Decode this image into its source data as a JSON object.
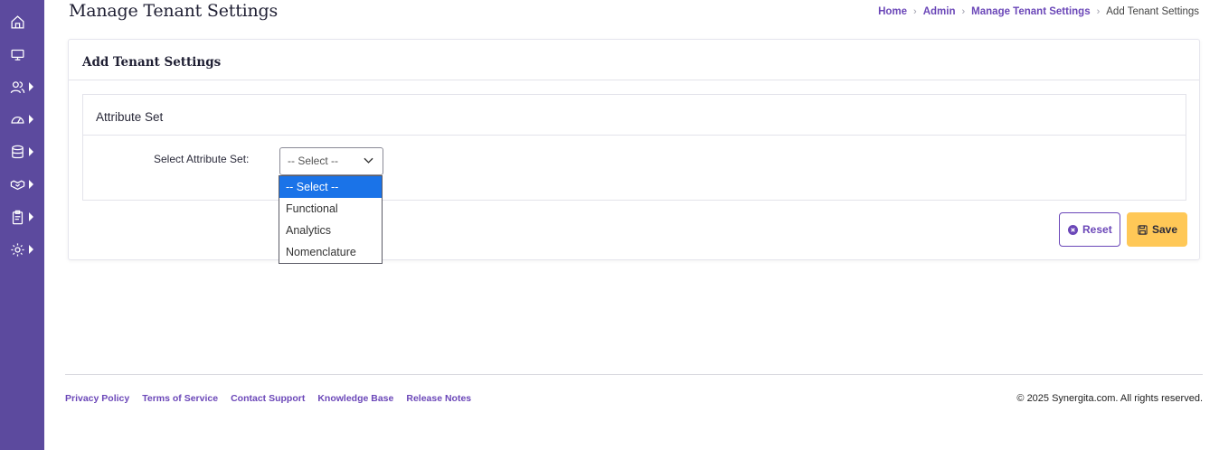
{
  "page": {
    "title": "Manage Tenant Settings"
  },
  "breadcrumb": {
    "items": [
      "Home",
      "Admin",
      "Manage Tenant Settings"
    ],
    "current": "Add Tenant Settings"
  },
  "card": {
    "title": "Add Tenant Settings"
  },
  "attribute_panel": {
    "title": "Attribute Set",
    "field_label": "Select Attribute Set:",
    "select_value": "-- Select --",
    "options": [
      "-- Select --",
      "Functional",
      "Analytics",
      "Nomenclature"
    ],
    "selected_index": 0
  },
  "actions": {
    "reset_label": "Reset",
    "save_label": "Save"
  },
  "footer": {
    "links": [
      "Privacy Policy",
      "Terms of Service",
      "Contact Support",
      "Knowledge Base",
      "Release Notes"
    ],
    "copyright": "© 2025 Synergita.com. All rights reserved."
  },
  "sidebar": {
    "items": [
      {
        "icon": "home-icon",
        "has_submenu": false
      },
      {
        "icon": "monitor-icon",
        "has_submenu": false
      },
      {
        "icon": "users-icon",
        "has_submenu": true
      },
      {
        "icon": "dashboard-gauge-icon",
        "has_submenu": true
      },
      {
        "icon": "database-icon",
        "has_submenu": true
      },
      {
        "icon": "handshake-icon",
        "has_submenu": true
      },
      {
        "icon": "clipboard-icon",
        "has_submenu": true
      },
      {
        "icon": "settings-gear-icon",
        "has_submenu": true
      }
    ]
  },
  "colors": {
    "sidebar": "#5c4a9e",
    "accent": "#6b47b8",
    "save_button": "#ffc857",
    "selected_option": "#1a73e8"
  }
}
